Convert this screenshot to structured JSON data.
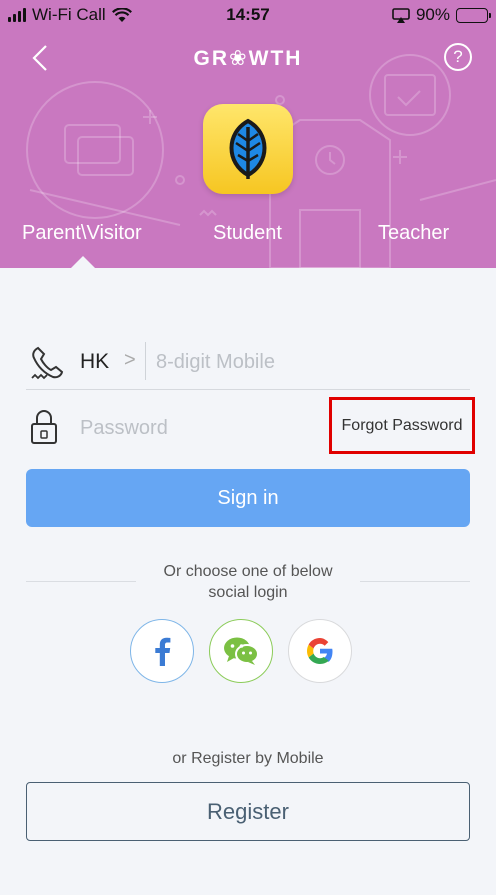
{
  "status_bar": {
    "carrier": "Wi-Fi Call",
    "time": "14:57",
    "battery": "90%",
    "battery_level": 0.9,
    "icons": [
      "signal-icon",
      "wifi-icon",
      "screen-mirror-icon",
      "battery-icon"
    ]
  },
  "header": {
    "brand": "GR❀WTH",
    "help": "?",
    "background_color": "#c978c0",
    "tabs": [
      {
        "label": "Parent\\Visitor",
        "selected": true
      },
      {
        "label": "Student",
        "selected": false
      },
      {
        "label": "Teacher",
        "selected": false
      }
    ]
  },
  "form": {
    "country_code": "HK",
    "chevron": ">",
    "mobile_placeholder": "8-digit Mobile",
    "password_placeholder": "Password",
    "forgot_password": "Forgot Password",
    "sign_in": "Sign in",
    "accent_color": "#66a6f3"
  },
  "social": {
    "label_line1": "Or choose one of below",
    "label_line2": "social login",
    "providers": [
      "facebook-icon",
      "wechat-icon",
      "google-icon"
    ]
  },
  "register": {
    "label": "or Register by Mobile",
    "button": "Register"
  }
}
